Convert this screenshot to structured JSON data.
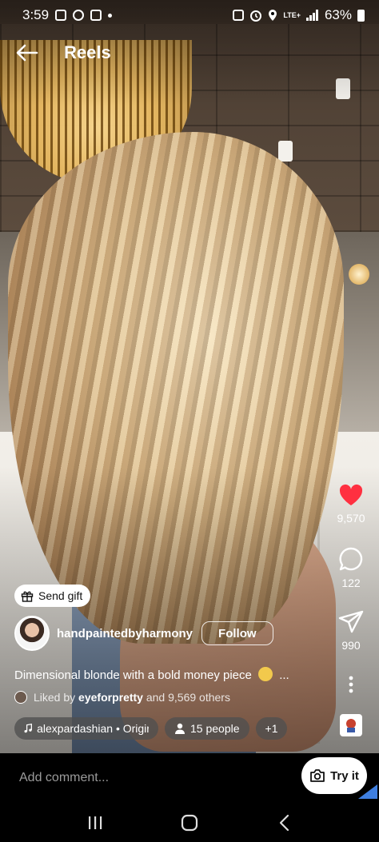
{
  "status_bar": {
    "time": "3:59",
    "network": "LTE+",
    "battery": "63%"
  },
  "header": {
    "title": "Reels"
  },
  "rail": {
    "likes": "9,570",
    "comments": "122",
    "shares": "990"
  },
  "post": {
    "send_gift_label": "Send gift",
    "username": "handpaintedbyharmony",
    "follow_label": "Follow",
    "caption": "Dimensional blonde with a bold money piece",
    "caption_more": "...",
    "liked_prefix": "Liked by",
    "liked_user": "eyeforpretty",
    "liked_suffix": "and 9,569 others",
    "audio": "alexpardashian • Original audio",
    "people": "15 people",
    "more_chip": "+1"
  },
  "comment_bar": {
    "placeholder": "Add comment...",
    "try_it_label": "Try it"
  },
  "colors": {
    "like_red": "#ff3040",
    "chip_bg": "#505050"
  },
  "icons": [
    "back-arrow-icon",
    "heart-icon",
    "comment-icon",
    "share-icon",
    "more-vert-icon",
    "gift-icon",
    "music-note-icon",
    "person-icon",
    "camera-icon",
    "recents-icon",
    "home-icon",
    "back-nav-icon"
  ]
}
